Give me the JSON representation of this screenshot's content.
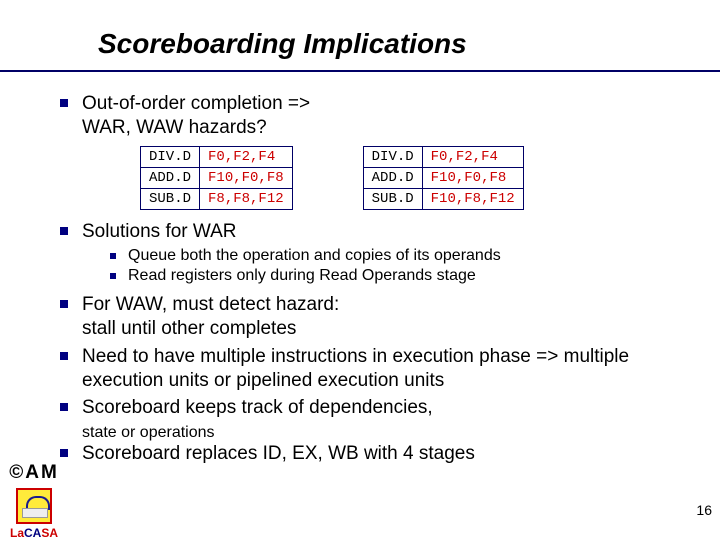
{
  "title": "Scoreboarding Implications",
  "bullets": {
    "b1": "Out-of-order completion =>\nWAR, WAW hazards?",
    "b2": "Solutions for WAR",
    "b2a": "Queue both the operation and copies of its operands",
    "b2b": "Read registers only during Read Operands stage",
    "b3": "For WAW, must detect hazard:\nstall until other completes",
    "b4": "Need to have multiple instructions in execution phase => multiple execution units or pipelined execution units",
    "b5": "Scoreboard keeps track of dependencies,",
    "b5b": "state or operations",
    "b6": "Scoreboard replaces ID, EX, WB with 4 stages"
  },
  "tableLeft": [
    {
      "op": "DIV.D",
      "reg": "F0,F2,F4"
    },
    {
      "op": "ADD.D",
      "reg": "F10,F0,F8"
    },
    {
      "op": "SUB.D",
      "reg": "F8,F8,F12"
    }
  ],
  "tableRight": [
    {
      "op": "DIV.D",
      "reg": "F0,F2,F4"
    },
    {
      "op": "ADD.D",
      "reg": "F10,F0,F8"
    },
    {
      "op": "SUB.D",
      "reg": "F10,F8,F12"
    }
  ],
  "logo": {
    "am": "©AM",
    "lacasa_p1": "La",
    "lacasa_p2": "CA",
    "lacasa_p3": "SA"
  },
  "page": "16"
}
